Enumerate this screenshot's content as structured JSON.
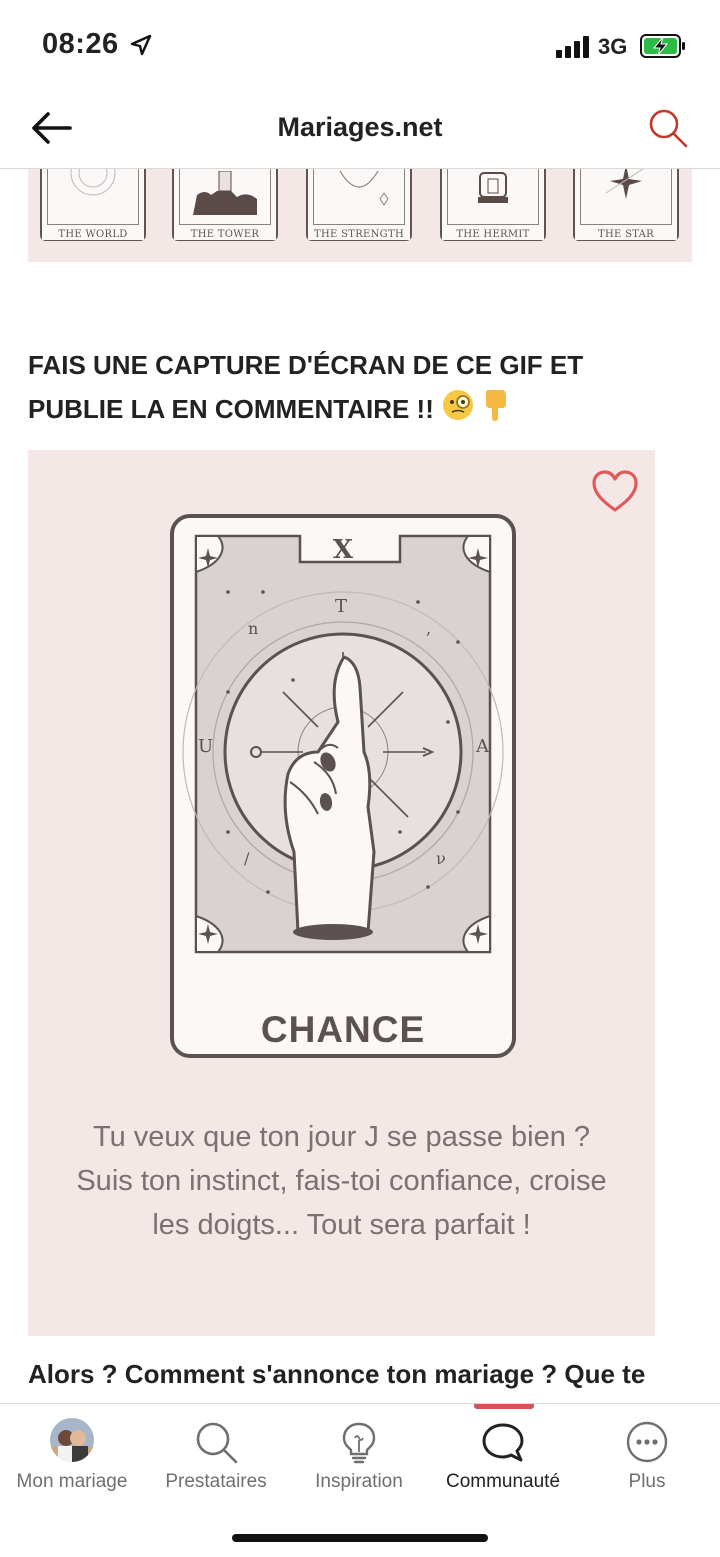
{
  "status_bar": {
    "time": "08:26",
    "network": "3G",
    "icons": [
      "location-arrow-icon",
      "signal-bars-icon",
      "battery-charging-icon"
    ]
  },
  "header": {
    "title": "Mariages.net",
    "back_icon": "arrow-left-icon",
    "search_icon": "search-icon",
    "accent_color": "#c0392b"
  },
  "tarot_strip": {
    "cards": [
      {
        "label": "THE WORLD"
      },
      {
        "label": "THE TOWER"
      },
      {
        "label": "THE STRENGTH"
      },
      {
        "label": "THE HERMIT"
      },
      {
        "label": "THE STAR"
      }
    ]
  },
  "post": {
    "heading": "FAIS UNE CAPTURE D'ÉCRAN DE CE GIF ET PUBLIE LA EN COMMENTAIRE !!",
    "heading_emojis": [
      "🧐",
      "👇"
    ],
    "gif": {
      "numeral": "X",
      "card_name": "CHANCE",
      "text": "Tu veux que ton jour J se passe bien ? Suis ton instinct, fais-toi confiance, croise les doigts... Tout sera parfait !",
      "background": "#f3e8e6",
      "heart_color": "#e05a5a"
    },
    "question": "Alors ? Comment s'annonce ton mariage ? Que te"
  },
  "tab_bar": {
    "tabs": [
      {
        "label": "Mon mariage",
        "icon": "avatar-photo"
      },
      {
        "label": "Prestataires",
        "icon": "search-icon"
      },
      {
        "label": "Inspiration",
        "icon": "lightbulb-icon"
      },
      {
        "label": "Communauté",
        "icon": "speech-bubble-icon",
        "active": true
      },
      {
        "label": "Plus",
        "icon": "more-dots-icon"
      }
    ],
    "active_color": "#d5545c"
  }
}
